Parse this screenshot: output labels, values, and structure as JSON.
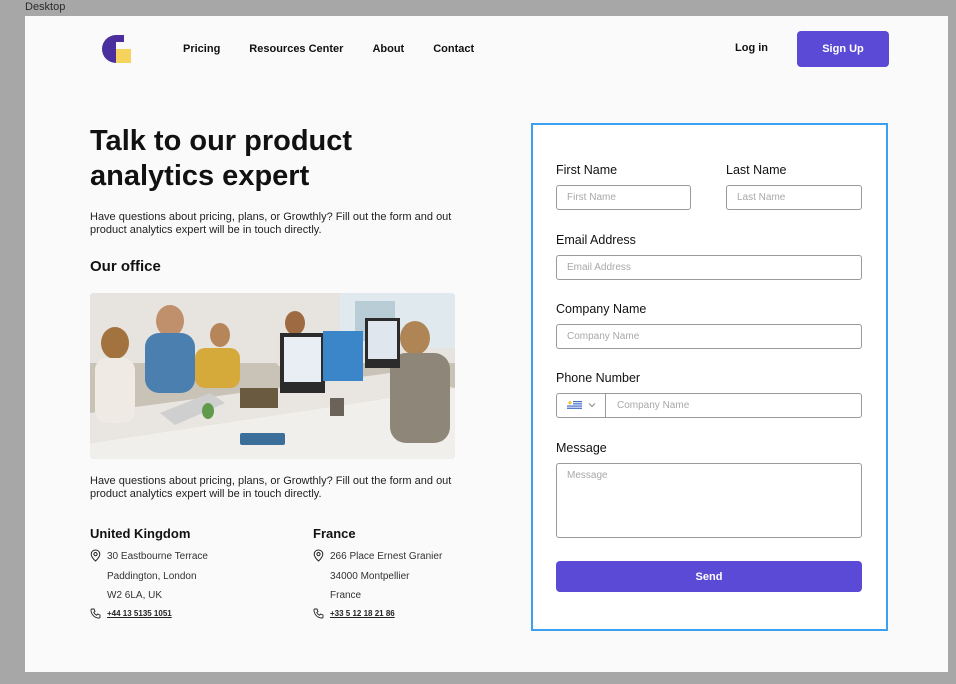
{
  "frame": {
    "label": "Desktop"
  },
  "header": {
    "nav": [
      "Pricing",
      "Resources Center",
      "About",
      "Contact"
    ],
    "login_label": "Log in",
    "signup_label": "Sign Up"
  },
  "hero": {
    "title": "Talk to our product analytics expert",
    "intro": "Have questions about pricing, plans, or Growthly? Fill out the form and out product analytics expert will be in touch directly.",
    "office_heading": "Our office",
    "intro_repeat": "Have questions about pricing, plans, or Growthly? Fill out the form and out product analytics expert will be in touch directly."
  },
  "offices": [
    {
      "country": "United Kingdom",
      "address": [
        "30 Eastbourne Terrace",
        "Paddington, London",
        "W2 6LA, UK"
      ],
      "phone": "+44 13 5135 1051"
    },
    {
      "country": "France",
      "address": [
        "266 Place Ernest Granier",
        "34000 Montpellier",
        "France"
      ],
      "phone": "+33 5 12 18 21 86"
    }
  ],
  "form": {
    "first_name_label": "First Name",
    "first_name_placeholder": "First Name",
    "last_name_label": "Last Name",
    "last_name_placeholder": "Last Name",
    "email_label": "Email Address",
    "email_placeholder": "Email Address",
    "company_label": "Company Name",
    "company_placeholder": "Company Name",
    "phone_label": "Phone Number",
    "phone_placeholder": "Company Name",
    "message_label": "Message",
    "message_placeholder": "Message",
    "send_label": "Send"
  },
  "colors": {
    "primary": "#5b4ad6",
    "card_border": "#3aa0ef",
    "logo_purple": "#4b2f9e",
    "logo_yellow": "#f6d35c"
  },
  "icons": [
    "logo-icon",
    "location-pin-icon",
    "phone-icon",
    "uruguay-flag-icon",
    "chevron-down-icon"
  ]
}
